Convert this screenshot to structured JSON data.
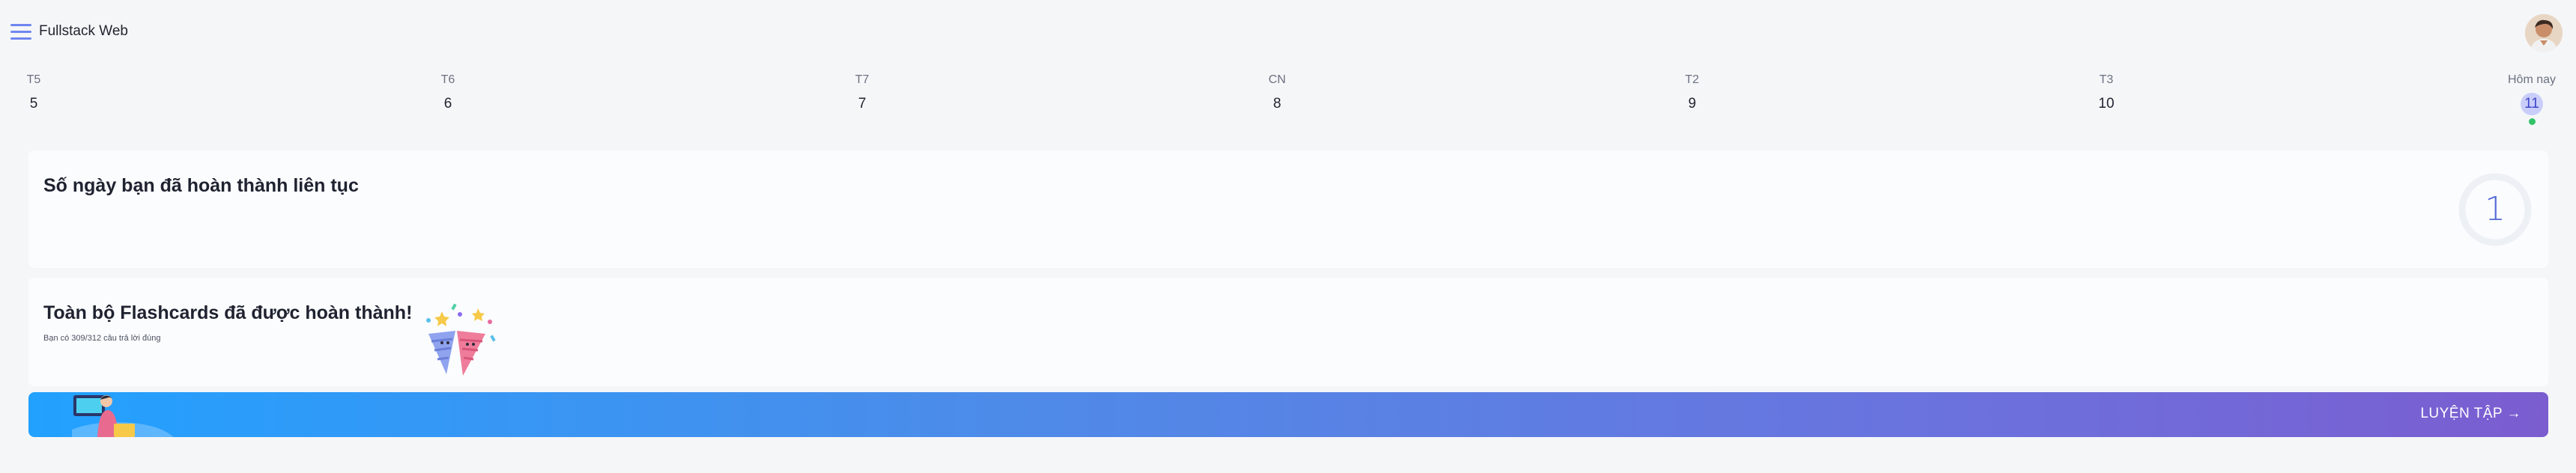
{
  "header": {
    "menu_icon": "hamburger-menu-icon",
    "title": "Fullstack Web",
    "avatar": "user-avatar"
  },
  "week": [
    {
      "dow": "T5",
      "num": "5"
    },
    {
      "dow": "T6",
      "num": "6"
    },
    {
      "dow": "T7",
      "num": "7"
    },
    {
      "dow": "CN",
      "num": "8"
    },
    {
      "dow": "T2",
      "num": "9"
    },
    {
      "dow": "T3",
      "num": "10"
    },
    {
      "dow": "Hôm nay",
      "num": "11",
      "today": true
    }
  ],
  "streak": {
    "title": "Số ngày bạn đã hoàn thành liên tục",
    "count": "1"
  },
  "flashcards": {
    "title": "Toàn bộ Flashcards đã được hoàn thành!",
    "subtitle": "Bạn có 309/312 câu trả lời đúng",
    "illustration": "party-popper-icon"
  },
  "banner": {
    "button_label": "LUYỆN TẬP →",
    "illustration": "student-laptop-icon"
  },
  "colors": {
    "accent": "#6f86f0",
    "today_bg": "#c9cdf9",
    "today_dot": "#34c268",
    "banner_start": "#22a1ff",
    "banner_end": "#7b5dd0"
  }
}
